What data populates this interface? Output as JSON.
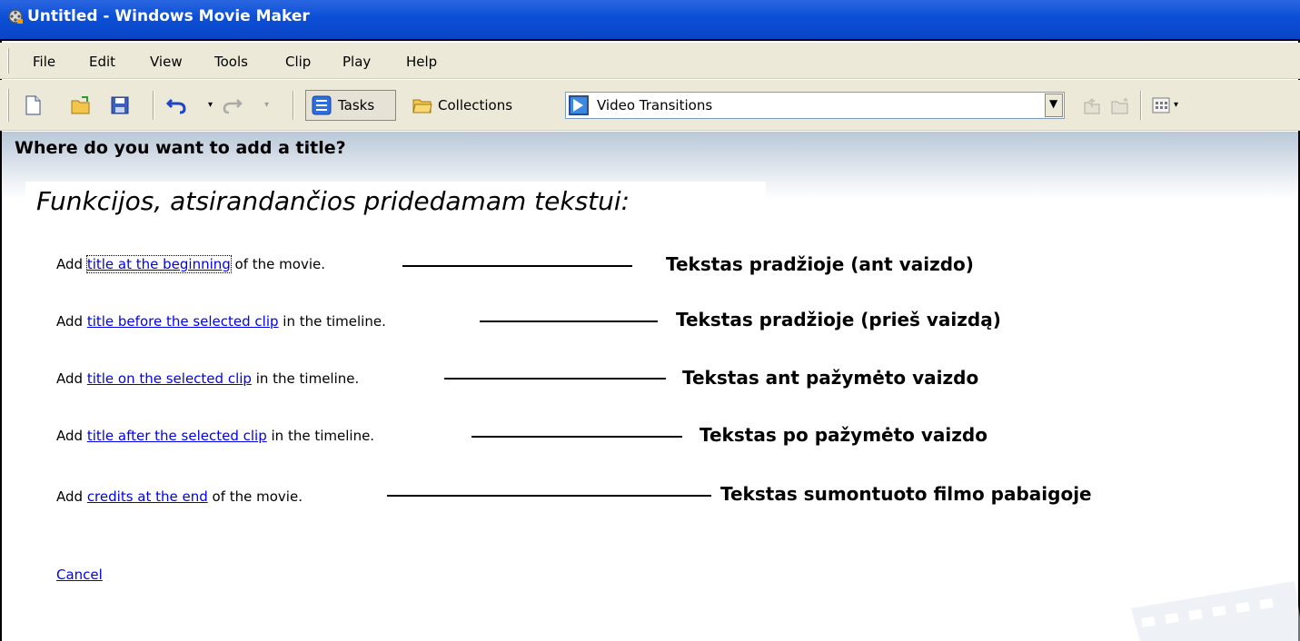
{
  "window": {
    "title": "Untitled - Windows Movie Maker"
  },
  "menu": {
    "items": [
      "File",
      "Edit",
      "View",
      "Tools",
      "Clip",
      "Play",
      "Help"
    ]
  },
  "toolbar": {
    "tasks_label": "Tasks",
    "collections_label": "Collections",
    "collections_combo_value": "Video Transitions",
    "icons": [
      "new-project-icon",
      "open-project-icon",
      "save-project-icon",
      "undo-icon",
      "redo-icon",
      "tasks-icon",
      "collections-folder-icon",
      "up-one-level-icon",
      "new-collection-folder-icon",
      "views-icon"
    ]
  },
  "main": {
    "heading": "Where do you want to add a title?",
    "subtitle": "Funkcijos, atsirandančios pridedamam tekstui:",
    "options": [
      {
        "prefix": "Add ",
        "link": "title at the beginning",
        "suffix": " of the movie.",
        "annotation": "Tekstas pradžioje (ant vaizdo)"
      },
      {
        "prefix": "Add ",
        "link": "title before the selected clip",
        "suffix": " in the timeline.",
        "annotation": "Tekstas pradžioje (prieš vaizdą)"
      },
      {
        "prefix": "Add ",
        "link": "title on the selected clip",
        "suffix": " in the timeline.",
        "annotation": "Tekstas ant pažymėto vaizdo"
      },
      {
        "prefix": "Add ",
        "link": "title after the selected clip",
        "suffix": " in the timeline.",
        "annotation": "Tekstas po pažymėto vaizdo"
      },
      {
        "prefix": "Add ",
        "link": "credits at the end",
        "suffix": " of the movie.",
        "annotation": "Tekstas sumontuoto filmo pabaigoje"
      }
    ],
    "cancel_label": "Cancel"
  },
  "colors": {
    "titlebar": "#0b4fd6",
    "chrome": "#ece9d8",
    "link": "#0000ee"
  }
}
